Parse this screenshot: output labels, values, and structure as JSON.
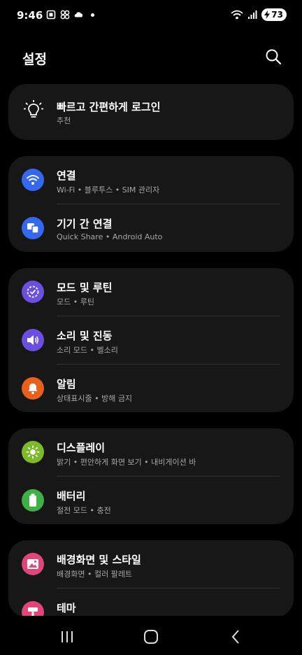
{
  "status": {
    "time": "9:46",
    "battery": "73"
  },
  "header": {
    "title": "설정"
  },
  "suggestion": {
    "title": "빠르고 간편하게 로그인",
    "subtitle": "추천"
  },
  "groups": [
    {
      "items": [
        {
          "title": "연결",
          "subtitle": "Wi-Fi • 블루투스 • SIM 관리자",
          "icon": "wifi-icon",
          "color": "#3468f0"
        },
        {
          "title": "기기 간 연결",
          "subtitle": "Quick Share • Android Auto",
          "icon": "device-connect-icon",
          "color": "#3468f0"
        }
      ]
    },
    {
      "items": [
        {
          "title": "모드 및 루틴",
          "subtitle": "모드 • 루틴",
          "icon": "modes-icon",
          "color": "#6b4fe0"
        },
        {
          "title": "소리 및 진동",
          "subtitle": "소리 모드 • 벨소리",
          "icon": "sound-icon",
          "color": "#6b4fe0"
        },
        {
          "title": "알림",
          "subtitle": "상태표시줄 • 방해 금지",
          "icon": "bell-icon",
          "color": "#e8601c"
        }
      ]
    },
    {
      "items": [
        {
          "title": "디스플레이",
          "subtitle": "밝기 • 편안하게 화면 보기 • 내비게이션 바",
          "icon": "sun-icon",
          "color": "#7db928"
        },
        {
          "title": "배터리",
          "subtitle": "절전 모드 • 충전",
          "icon": "battery-icon",
          "color": "#3fb045"
        }
      ]
    },
    {
      "items": [
        {
          "title": "배경화면 및 스타일",
          "subtitle": "배경화면 • 컬러 팔레트",
          "icon": "wallpaper-icon",
          "color": "#e0467a"
        },
        {
          "title": "테마",
          "subtitle": "",
          "icon": "theme-icon",
          "color": "#e0467a"
        }
      ]
    }
  ]
}
